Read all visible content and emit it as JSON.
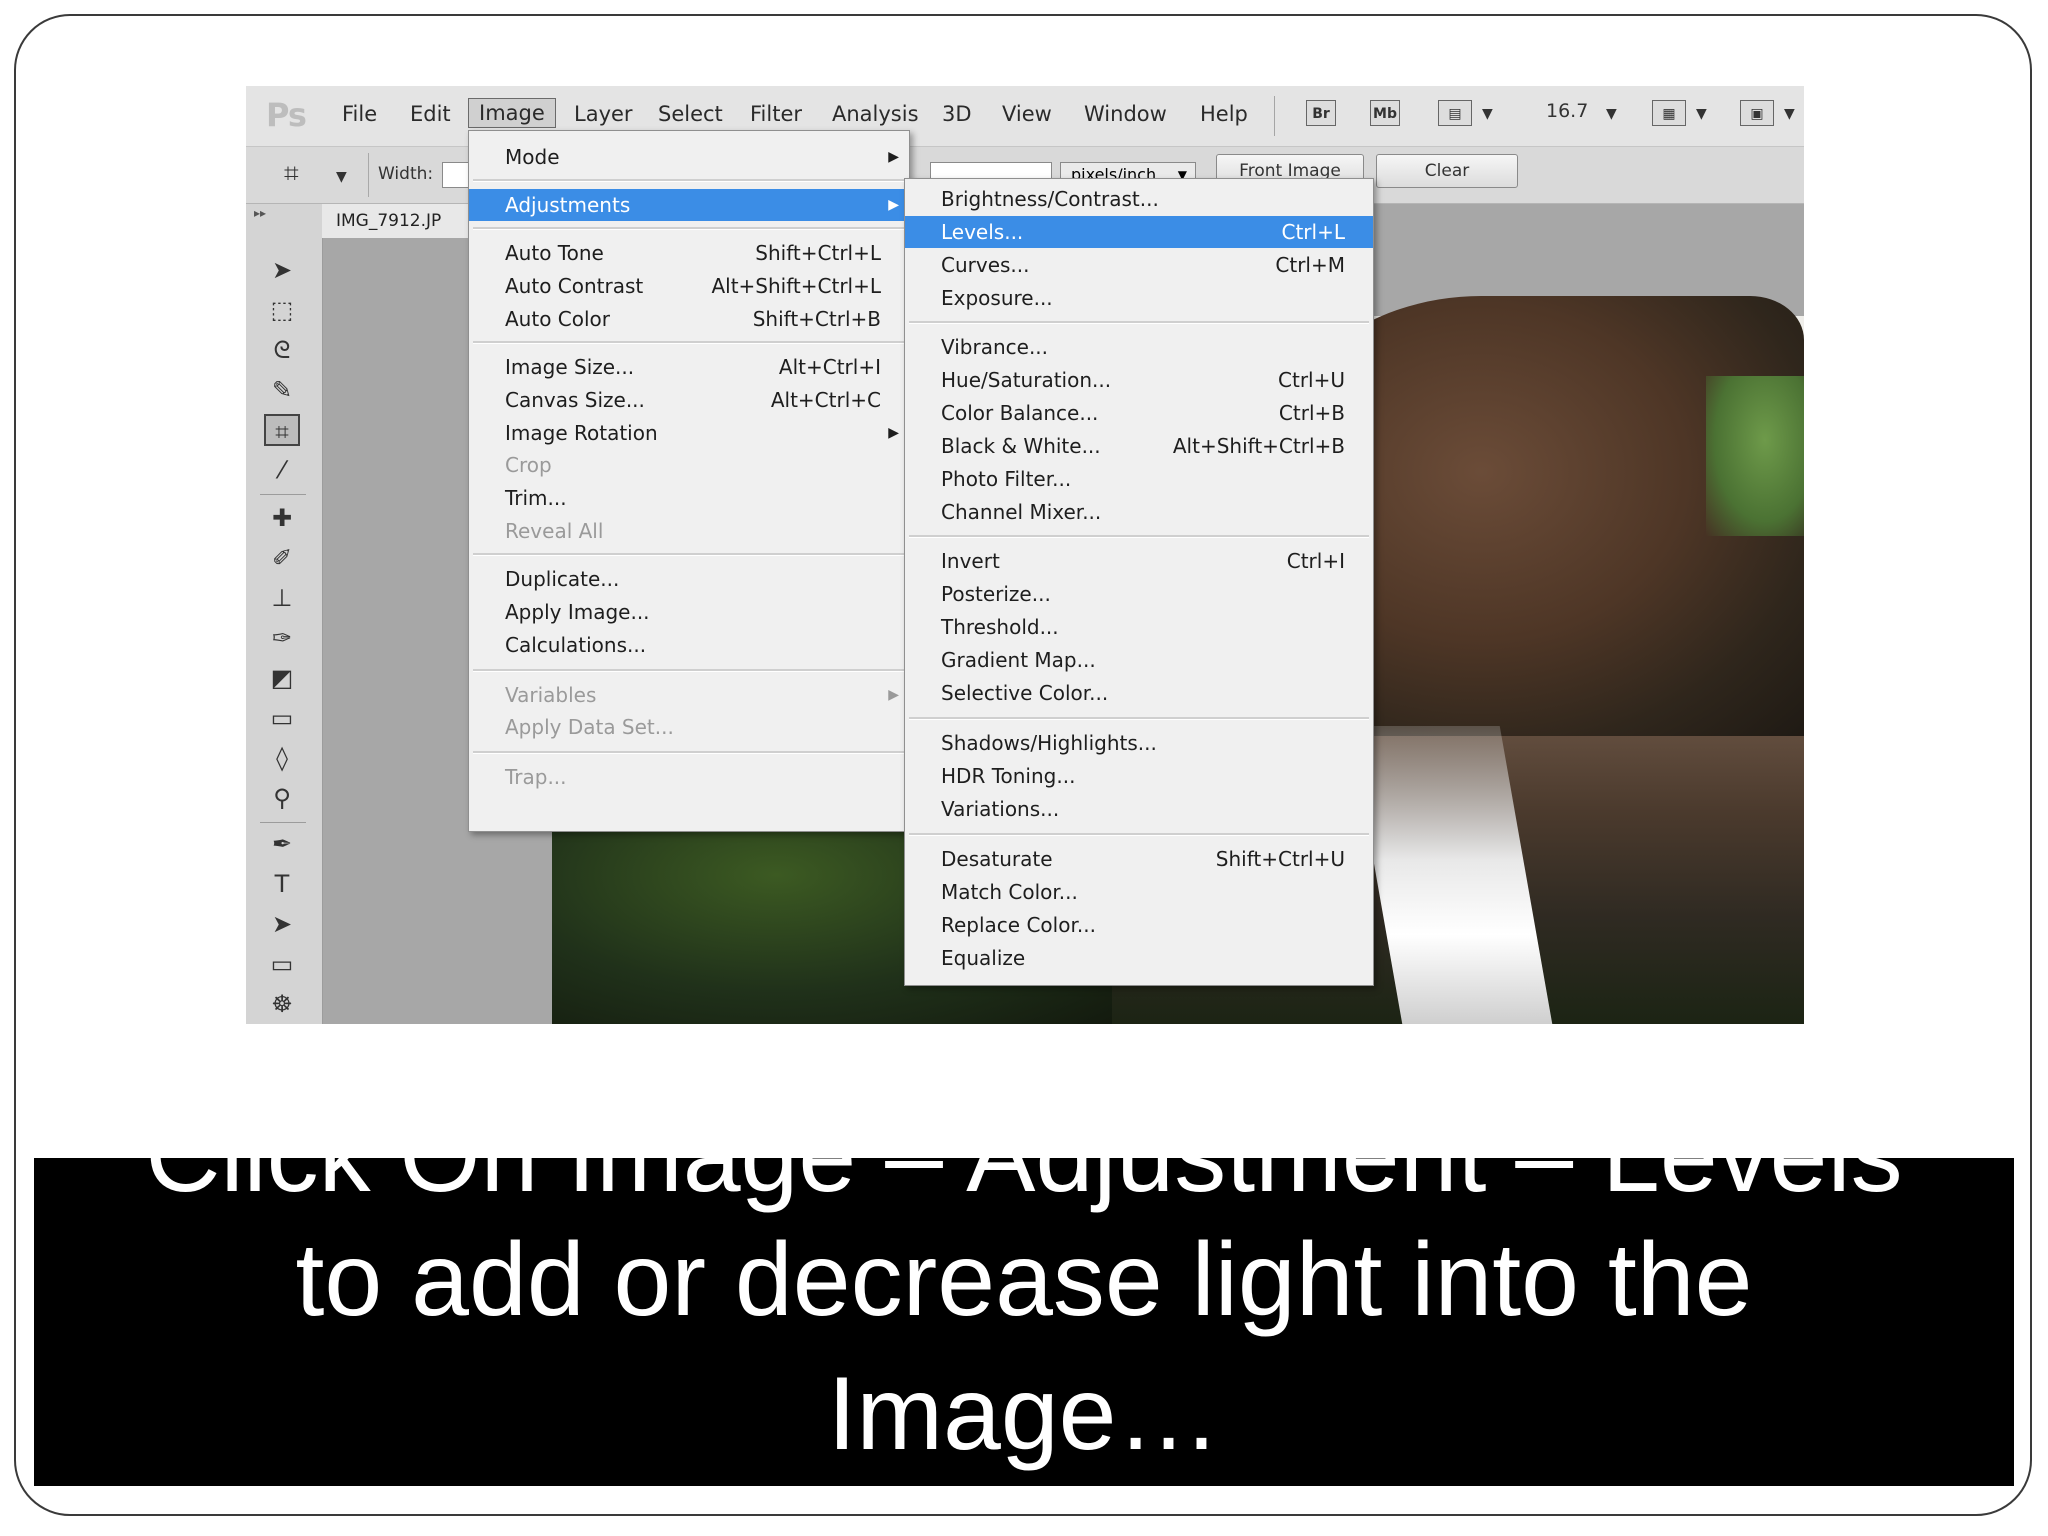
{
  "app": {
    "logo": "Ps",
    "menu": [
      "File",
      "Edit",
      "Image",
      "Layer",
      "Select",
      "Filter",
      "Analysis",
      "3D",
      "View",
      "Window",
      "Help"
    ],
    "active_menu": "Image",
    "right_tools": {
      "bridge": "Br",
      "mini_bridge": "Mb",
      "zoom": "16.7"
    }
  },
  "options_bar": {
    "width_label": "Width:",
    "resolution_unit": "pixels/inch",
    "front_image_button": "Front Image",
    "clear_button": "Clear"
  },
  "document": {
    "tab_title": "IMG_7912.JP"
  },
  "image_menu": {
    "items": [
      {
        "label": "Mode",
        "shortcut": "",
        "submenu": true,
        "disabled": false
      },
      {
        "label": "Adjustments",
        "shortcut": "",
        "submenu": true,
        "disabled": false,
        "highlighted": true
      },
      {
        "label": "Auto Tone",
        "shortcut": "Shift+Ctrl+L",
        "disabled": false
      },
      {
        "label": "Auto Contrast",
        "shortcut": "Alt+Shift+Ctrl+L",
        "disabled": false
      },
      {
        "label": "Auto Color",
        "shortcut": "Shift+Ctrl+B",
        "disabled": false
      },
      {
        "label": "Image Size...",
        "shortcut": "Alt+Ctrl+I",
        "disabled": false
      },
      {
        "label": "Canvas Size...",
        "shortcut": "Alt+Ctrl+C",
        "disabled": false
      },
      {
        "label": "Image Rotation",
        "shortcut": "",
        "submenu": true,
        "disabled": false
      },
      {
        "label": "Crop",
        "shortcut": "",
        "disabled": true
      },
      {
        "label": "Trim...",
        "shortcut": "",
        "disabled": false
      },
      {
        "label": "Reveal All",
        "shortcut": "",
        "disabled": true
      },
      {
        "label": "Duplicate...",
        "shortcut": "",
        "disabled": false
      },
      {
        "label": "Apply Image...",
        "shortcut": "",
        "disabled": false
      },
      {
        "label": "Calculations...",
        "shortcut": "",
        "disabled": false
      },
      {
        "label": "Variables",
        "shortcut": "",
        "submenu": true,
        "disabled": true
      },
      {
        "label": "Apply Data Set...",
        "shortcut": "",
        "disabled": true
      },
      {
        "label": "Trap...",
        "shortcut": "",
        "disabled": true
      }
    ]
  },
  "adjustments_menu": {
    "items": [
      {
        "label": "Brightness/Contrast...",
        "shortcut": ""
      },
      {
        "label": "Levels...",
        "shortcut": "Ctrl+L",
        "highlighted": true
      },
      {
        "label": "Curves...",
        "shortcut": "Ctrl+M"
      },
      {
        "label": "Exposure...",
        "shortcut": ""
      },
      {
        "label": "Vibrance...",
        "shortcut": ""
      },
      {
        "label": "Hue/Saturation...",
        "shortcut": "Ctrl+U"
      },
      {
        "label": "Color Balance...",
        "shortcut": "Ctrl+B"
      },
      {
        "label": "Black & White...",
        "shortcut": "Alt+Shift+Ctrl+B"
      },
      {
        "label": "Photo Filter...",
        "shortcut": ""
      },
      {
        "label": "Channel Mixer...",
        "shortcut": ""
      },
      {
        "label": "Invert",
        "shortcut": "Ctrl+I"
      },
      {
        "label": "Posterize...",
        "shortcut": ""
      },
      {
        "label": "Threshold...",
        "shortcut": ""
      },
      {
        "label": "Gradient Map...",
        "shortcut": ""
      },
      {
        "label": "Selective Color...",
        "shortcut": ""
      },
      {
        "label": "Shadows/Highlights...",
        "shortcut": ""
      },
      {
        "label": "HDR Toning...",
        "shortcut": ""
      },
      {
        "label": "Variations...",
        "shortcut": ""
      },
      {
        "label": "Desaturate",
        "shortcut": "Shift+Ctrl+U"
      },
      {
        "label": "Match Color...",
        "shortcut": ""
      },
      {
        "label": "Replace Color...",
        "shortcut": ""
      },
      {
        "label": "Equalize",
        "shortcut": ""
      }
    ]
  },
  "caption": {
    "line1": "Click On Image – Adjustment – Levels",
    "line2": "to add or decrease light into the",
    "line3": "Image…"
  },
  "colors": {
    "menu_highlight": "#3b8de6",
    "caption_background": "#000000",
    "caption_text": "#ffffff"
  }
}
